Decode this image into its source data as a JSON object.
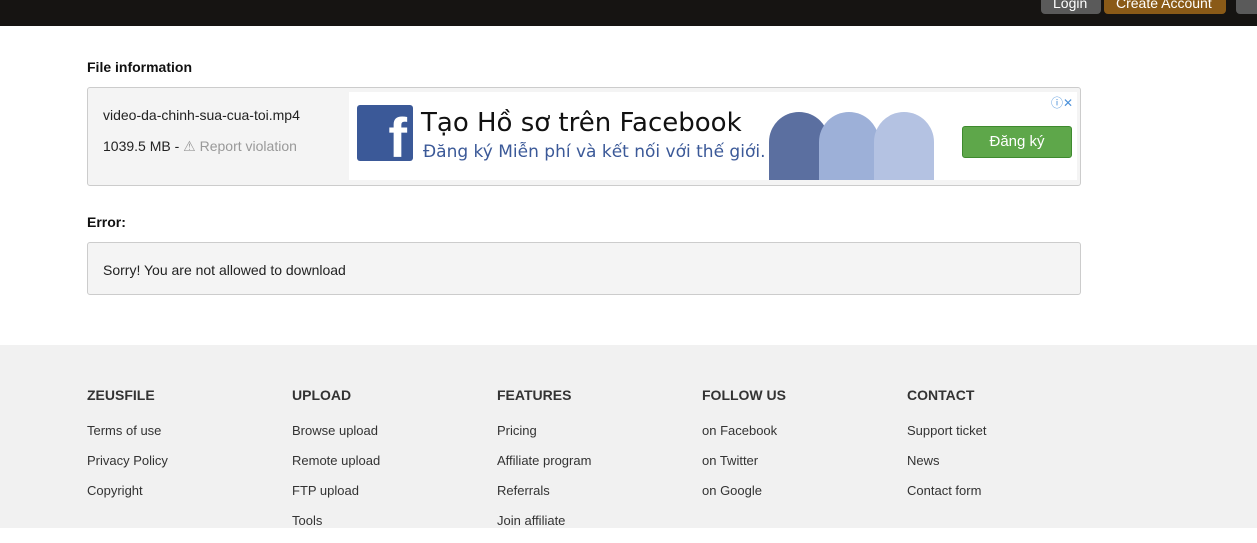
{
  "header": {
    "login": "Login",
    "create_account": "Create Account"
  },
  "file_info": {
    "heading": "File information",
    "filename": "video-da-chinh-sua-cua-toi.mp4",
    "size": "1039.5 MB -",
    "report": "Report violation"
  },
  "ad": {
    "title": "Tạo Hồ sơ trên Facebook",
    "subtitle": "Đăng ký Miễn phí và kết nối với thế giới.",
    "button": "Đăng ký"
  },
  "error": {
    "heading": "Error:",
    "message": "Sorry! You are not allowed to download"
  },
  "footer": [
    {
      "title": "ZEUSFILE",
      "links": [
        "Terms of use",
        "Privacy Policy",
        "Copyright"
      ]
    },
    {
      "title": "UPLOAD",
      "links": [
        "Browse upload",
        "Remote upload",
        "FTP upload",
        "Tools"
      ]
    },
    {
      "title": "FEATURES",
      "links": [
        "Pricing",
        "Affiliate program",
        "Referrals",
        "Join affiliate"
      ]
    },
    {
      "title": "FOLLOW US",
      "links": [
        "on Facebook",
        "on Twitter",
        "on Google"
      ]
    },
    {
      "title": "CONTACT",
      "links": [
        "Support ticket",
        "News",
        "Contact form"
      ]
    }
  ]
}
